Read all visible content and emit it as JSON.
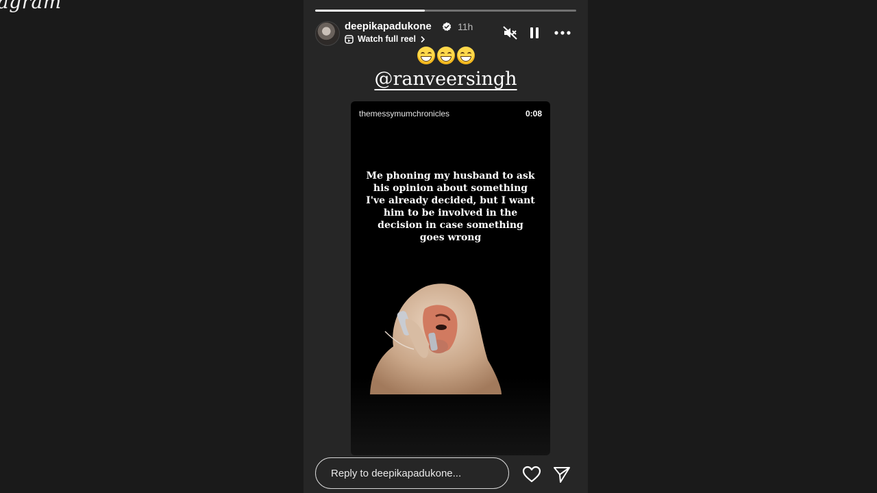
{
  "brand": {
    "text": "agram"
  },
  "story": {
    "progress_fraction": 0.42,
    "user": {
      "username": "deepikapadukone",
      "time": "11h"
    },
    "watch_full_reel": "Watch full reel",
    "sticker_mention": "@ranveersingh",
    "reel": {
      "author": "themessymumchronicles",
      "duration": "0:08",
      "caption": "Me phoning my husband to ask his opinion about something I've already decided, but I want him to be involved in the decision in case something goes wrong"
    },
    "reply_placeholder": "Reply to deepikapadukone..."
  },
  "icons": [
    "verified-icon",
    "reel-icon",
    "chevron-right-icon",
    "muted-speaker-icon",
    "pause-icon",
    "more-icon",
    "grinning-emoji-icon",
    "heart-icon",
    "send-icon"
  ],
  "colors": {
    "background": "#1a1a1a",
    "story_bg": "#262626",
    "text": "#ffffff",
    "secondary_text": "#bdbdbd"
  }
}
